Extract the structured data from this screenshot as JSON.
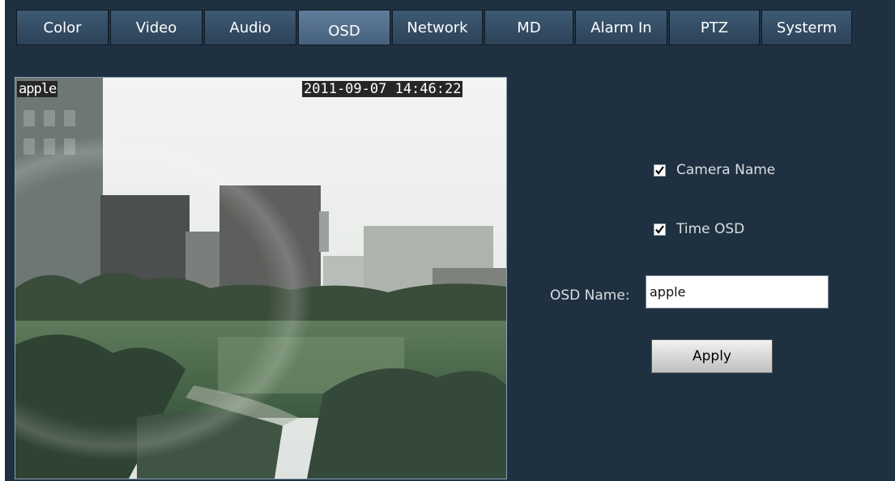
{
  "tabs": [
    {
      "label": "Color",
      "w": 114
    },
    {
      "label": "Video",
      "w": 114
    },
    {
      "label": "Audio",
      "w": 114
    },
    {
      "label": "OSD",
      "w": 114,
      "active": true
    },
    {
      "label": "Network",
      "w": 112
    },
    {
      "label": "MD",
      "w": 110
    },
    {
      "label": "Alarm In",
      "w": 114
    },
    {
      "label": "PTZ",
      "w": 112
    },
    {
      "label": "Systerm",
      "w": 112
    }
  ],
  "video": {
    "osd_name_text": "apple",
    "osd_time_text": "2011-09-07 14:46:22"
  },
  "settings": {
    "camera_name_label": "Camera Name",
    "camera_name_checked": true,
    "time_osd_label": "Time OSD",
    "time_osd_checked": true,
    "osd_name_label": "OSD Name:",
    "osd_name_value": "apple",
    "apply_label": "Apply"
  },
  "colors": {
    "background": "#1f3140",
    "tab": "#3e5a74",
    "tab_active": "#617d99"
  }
}
